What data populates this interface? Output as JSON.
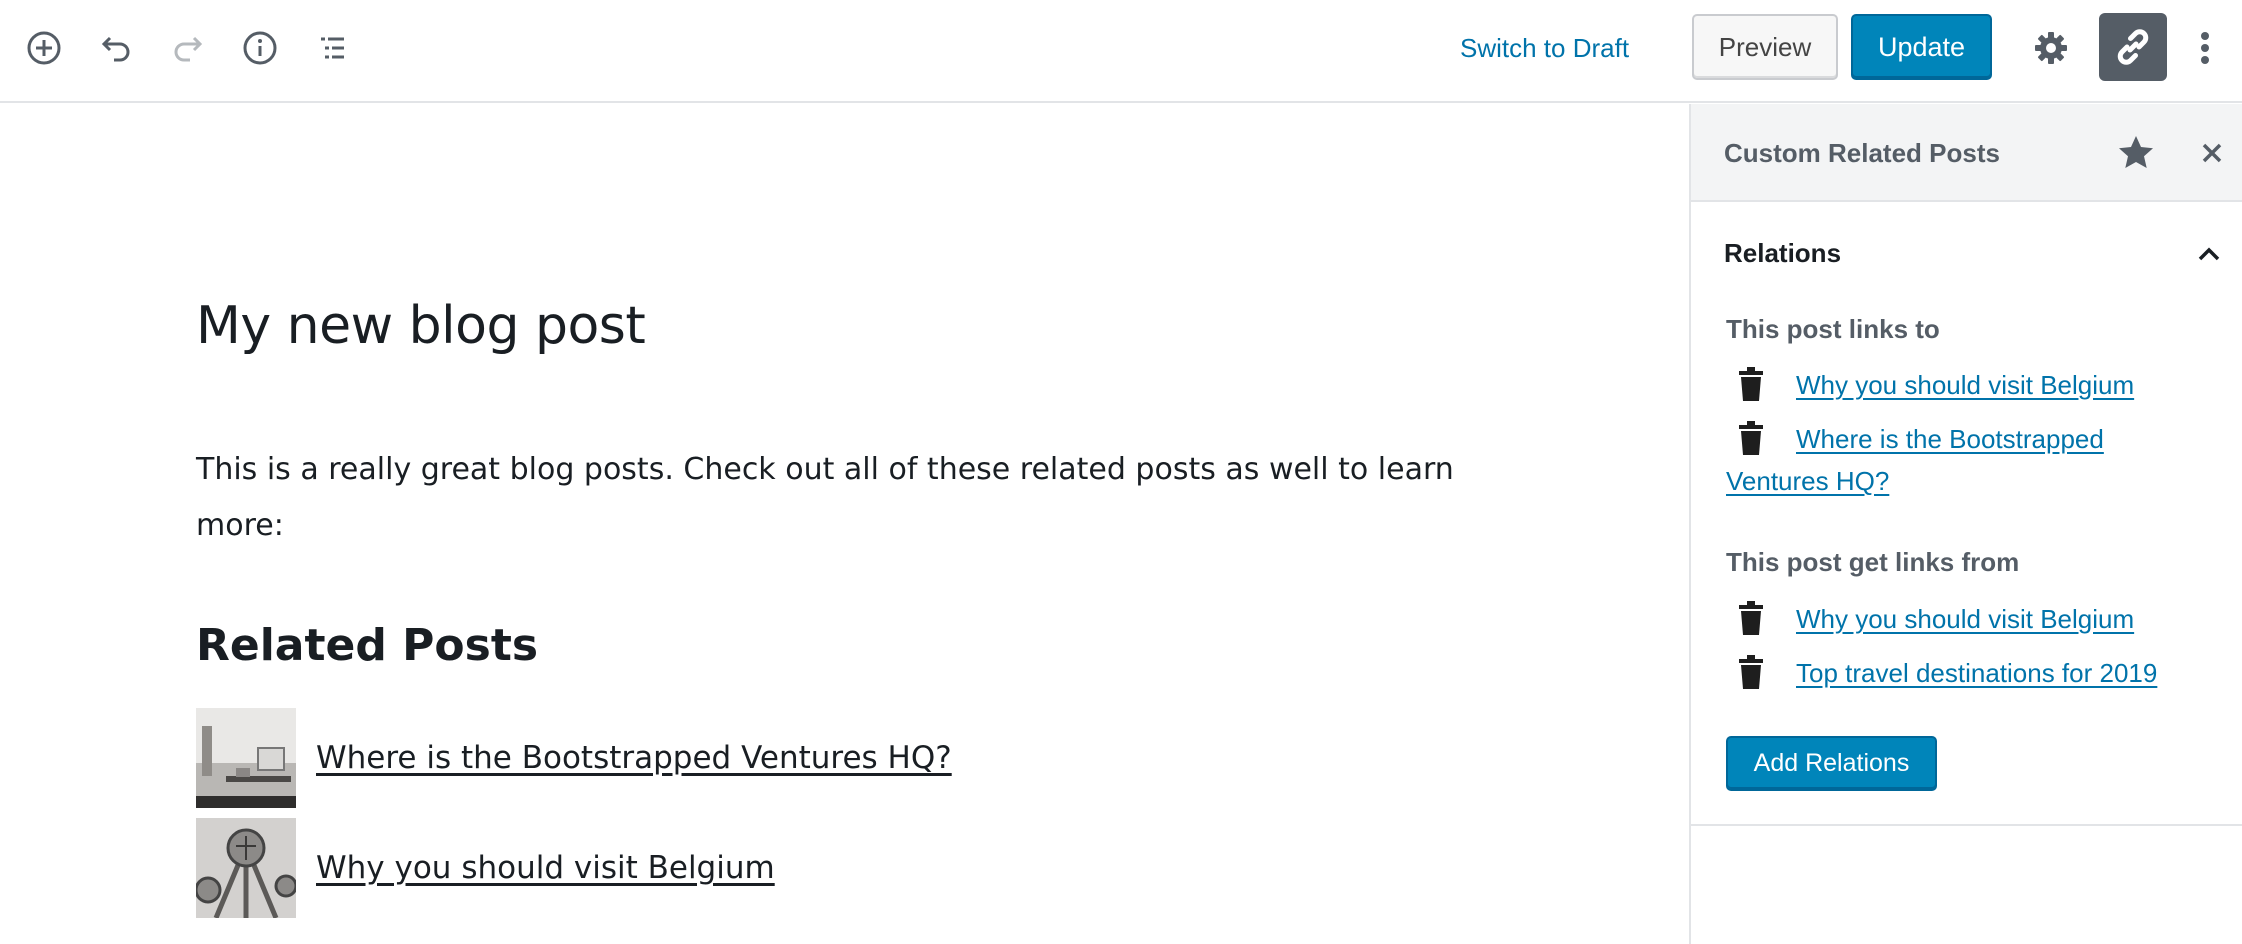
{
  "toolbar": {
    "icons": [
      "add-block-icon",
      "undo-icon",
      "redo-icon",
      "info-icon",
      "outline-icon"
    ],
    "switch_to_draft": "Switch to Draft",
    "preview": "Preview",
    "update": "Update",
    "right_icons": [
      "gear-icon",
      "link-icon",
      "more-vertical-icon"
    ]
  },
  "editor": {
    "title": "My new blog post",
    "paragraph": "This is a really great blog posts. Check out all of these related posts as well to learn more:",
    "related_heading": "Related Posts",
    "related_posts": [
      {
        "title": "Where is the Bootstrapped Ventures HQ?"
      },
      {
        "title": "Why you should visit Belgium"
      }
    ]
  },
  "sidebar": {
    "title": "Custom Related Posts",
    "panel": {
      "title": "Relations",
      "links_to_label": "This post links to",
      "links_to": [
        "Why you should visit Belgium",
        "Where is the Bootstrapped Ventures HQ?"
      ],
      "links_from_label": "This post get links from",
      "links_from": [
        "Why you should visit Belgium",
        "Top travel destinations for 2019"
      ],
      "add_button": "Add Relations"
    }
  },
  "colors": {
    "accent": "#0085ba",
    "link": "#0073aa",
    "active_toggle": "#555d66"
  }
}
